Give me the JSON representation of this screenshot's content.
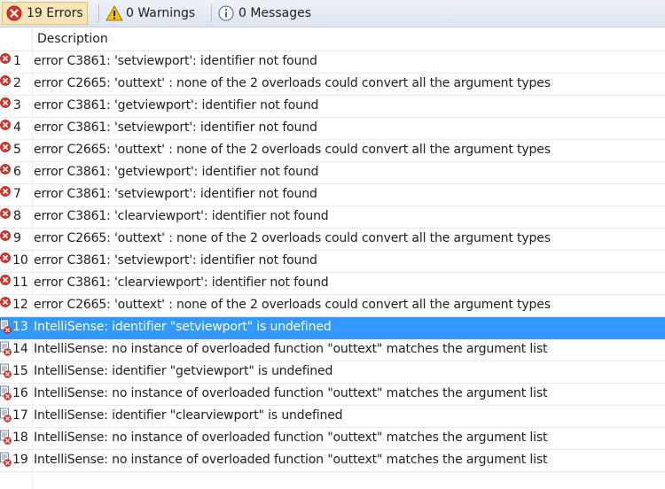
{
  "toolbar": {
    "errors_label": "19 Errors",
    "warnings_label": "0 Warnings",
    "messages_label": "0 Messages"
  },
  "header": {
    "description": "Description"
  },
  "colors": {
    "selected": "#3399ff",
    "error": "#d9342b",
    "warning": "#f4c20d",
    "info": "#2e6bbd"
  },
  "rows": [
    {
      "num": "1",
      "desc": "error C3861: 'setviewport': identifier not found",
      "type": "error"
    },
    {
      "num": "2",
      "desc": "error C2665: 'outtext' : none of the 2 overloads could convert all the argument types",
      "type": "error"
    },
    {
      "num": "3",
      "desc": "error C3861: 'getviewport': identifier not found",
      "type": "error"
    },
    {
      "num": "4",
      "desc": "error C3861: 'setviewport': identifier not found",
      "type": "error"
    },
    {
      "num": "5",
      "desc": "error C2665: 'outtext' : none of the 2 overloads could convert all the argument types",
      "type": "error"
    },
    {
      "num": "6",
      "desc": "error C3861: 'getviewport': identifier not found",
      "type": "error"
    },
    {
      "num": "7",
      "desc": "error C3861: 'setviewport': identifier not found",
      "type": "error"
    },
    {
      "num": "8",
      "desc": "error C3861: 'clearviewport': identifier not found",
      "type": "error"
    },
    {
      "num": "9",
      "desc": "error C2665: 'outtext' : none of the 2 overloads could convert all the argument types",
      "type": "error"
    },
    {
      "num": "10",
      "desc": "error C3861: 'setviewport': identifier not found",
      "type": "error"
    },
    {
      "num": "11",
      "desc": "error C3861: 'clearviewport': identifier not found",
      "type": "error"
    },
    {
      "num": "12",
      "desc": "error C2665: 'outtext' : none of the 2 overloads could convert all the argument types",
      "type": "error"
    },
    {
      "num": "13",
      "desc": "IntelliSense: identifier \"setviewport\" is undefined",
      "type": "intellisense",
      "selected": true
    },
    {
      "num": "14",
      "desc": "IntelliSense: no instance of overloaded function \"outtext\" matches the argument list",
      "type": "intellisense"
    },
    {
      "num": "15",
      "desc": "IntelliSense: identifier \"getviewport\" is undefined",
      "type": "intellisense"
    },
    {
      "num": "16",
      "desc": "IntelliSense: no instance of overloaded function \"outtext\" matches the argument list",
      "type": "intellisense"
    },
    {
      "num": "17",
      "desc": "IntelliSense: identifier \"clearviewport\" is undefined",
      "type": "intellisense"
    },
    {
      "num": "18",
      "desc": "IntelliSense: no instance of overloaded function \"outtext\" matches the argument list",
      "type": "intellisense"
    },
    {
      "num": "19",
      "desc": "IntelliSense: no instance of overloaded function \"outtext\" matches the argument list",
      "type": "intellisense"
    }
  ]
}
